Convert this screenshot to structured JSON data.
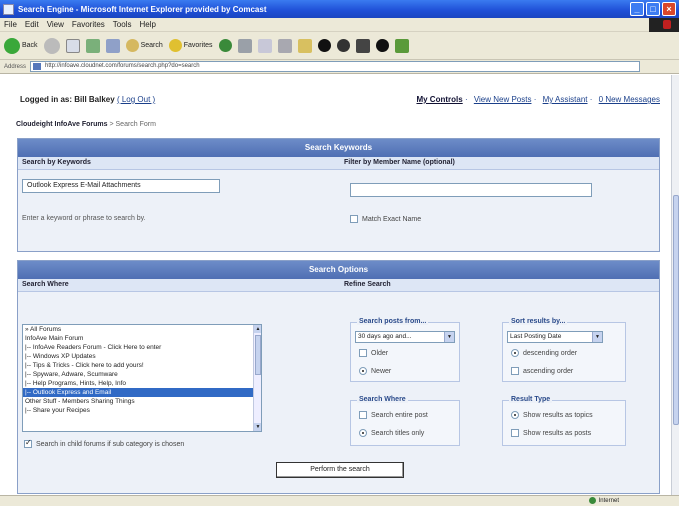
{
  "window": {
    "title": "Search Engine - Microsoft Internet Explorer provided by Comcast"
  },
  "menu": [
    "File",
    "Edit",
    "View",
    "Favorites",
    "Tools",
    "Help"
  ],
  "toolbar": {
    "back_label": "Back",
    "search_label": "Search",
    "favorites_label": "Favorites"
  },
  "address": {
    "label": "Address",
    "url": "http://infoave.cloudnet.com/forums/search.php?do=search"
  },
  "user": {
    "logged_in_label": "Logged in as:",
    "name": "Bill Balkey",
    "logout_label": "( Log Out )",
    "links": [
      "My Controls",
      "View New Posts",
      "My Assistant",
      "0 New Messages"
    ]
  },
  "breadcrumb": {
    "home": "Cloudeight InfoAve Forums",
    "current": "> Search Form"
  },
  "keywords_panel": {
    "title": "Search Keywords",
    "by_keywords": "Search by Keywords",
    "by_member": "Filter by Member Name (optional)",
    "keyword_value": "Outlook Express E-Mail Attachments",
    "member_value": "",
    "hint": "Enter a keyword or phrase to search by.",
    "match_exact": "Match Exact Name"
  },
  "options_panel": {
    "title": "Search Options",
    "search_where": "Search Where",
    "refine": "Refine Search",
    "forums": [
      "» All Forums",
      "InfoAve Main Forum",
      "|-- InfoAve Readers Forum - Click Here to enter",
      "|-- Windows XP Updates",
      "|-- Tips & Tricks - Click here to add yours!",
      "|-- Spyware, Adware, Scumware",
      "|-- Help Programs, Hints, Help, Info",
      "|-- Outlook Express and Email",
      "Other Stuff - Members Sharing Things",
      "|-- Share your Recipes"
    ],
    "selected_forum_index": 7,
    "child_forums": "Search in child forums if sub category is chosen",
    "posts_from": {
      "legend": "Search posts from...",
      "select_value": "30 days ago and...",
      "older": "Older",
      "newer": "Newer"
    },
    "sort_by": {
      "legend": "Sort results by...",
      "select_value": "Last Posting Date",
      "desc": "descending order",
      "asc": "ascending order"
    },
    "search_where_box": {
      "legend": "Search Where",
      "entire": "Search entire post",
      "titles": "Search titles only"
    },
    "result_type": {
      "legend": "Result Type",
      "topics": "Show results as topics",
      "posts": "Show results as posts"
    },
    "perform_label": "Perform the search"
  },
  "status": {
    "zone": "Internet"
  }
}
